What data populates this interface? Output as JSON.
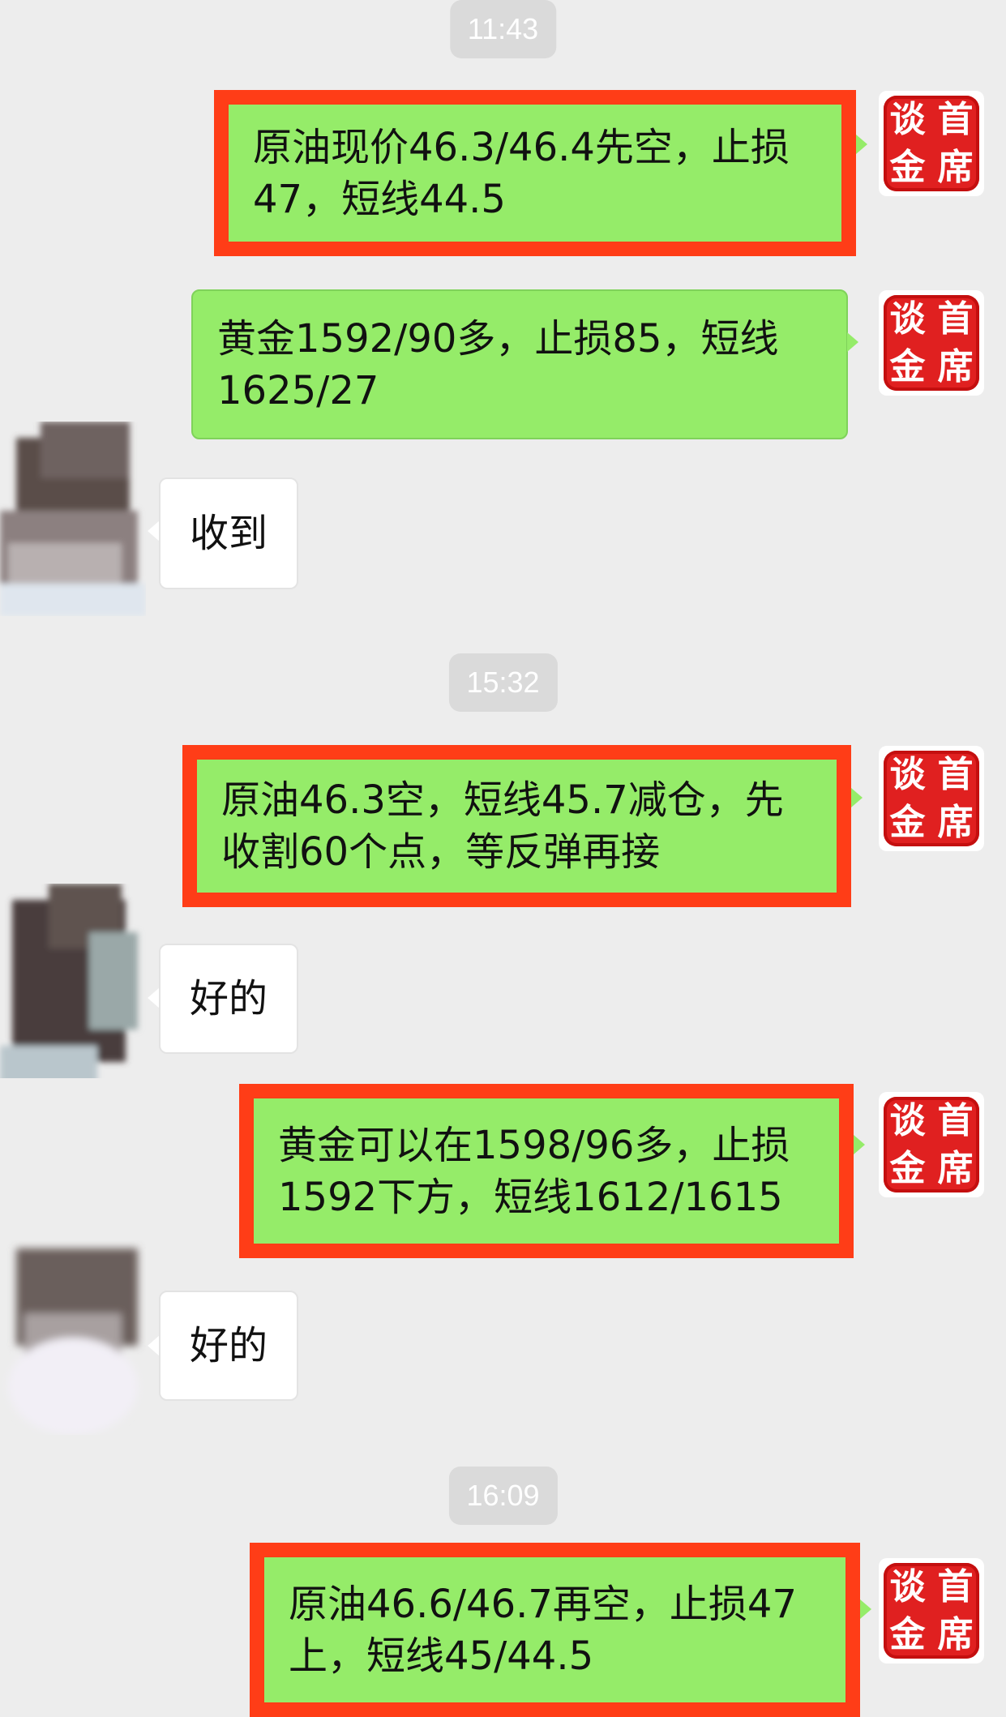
{
  "self_avatar": {
    "seal_chars": [
      "谈",
      "首",
      "金",
      "席"
    ]
  },
  "timestamps": [
    "11:43",
    "15:32",
    "16:09"
  ],
  "messages": [
    {
      "side": "right",
      "text": "原油现价46.3/46.4先空，止损\n47，短线44.5",
      "highlighted": true
    },
    {
      "side": "right",
      "text": "黄金1592/90多，止损85，短线\n1625/27",
      "highlighted": false
    },
    {
      "side": "left",
      "text": "收到"
    },
    {
      "side": "right",
      "text": "原油46.3空，短线45.7减仓，先\n收割60个点，等反弹再接",
      "highlighted": true
    },
    {
      "side": "left",
      "text": "好的"
    },
    {
      "side": "right",
      "text": "黄金可以在1598/96多，止损\n1592下方，短线1612/1615",
      "highlighted": true
    },
    {
      "side": "left",
      "text": "好的"
    },
    {
      "side": "right",
      "text": "原油46.6/46.7再空，止损47\n上，短线45/44.5",
      "highlighted": true
    }
  ],
  "colors": {
    "background": "#ededed",
    "self_bubble": "#95ec69",
    "other_bubble": "#ffffff",
    "highlight_box": "#ff3d17",
    "seal": "#e02020"
  }
}
